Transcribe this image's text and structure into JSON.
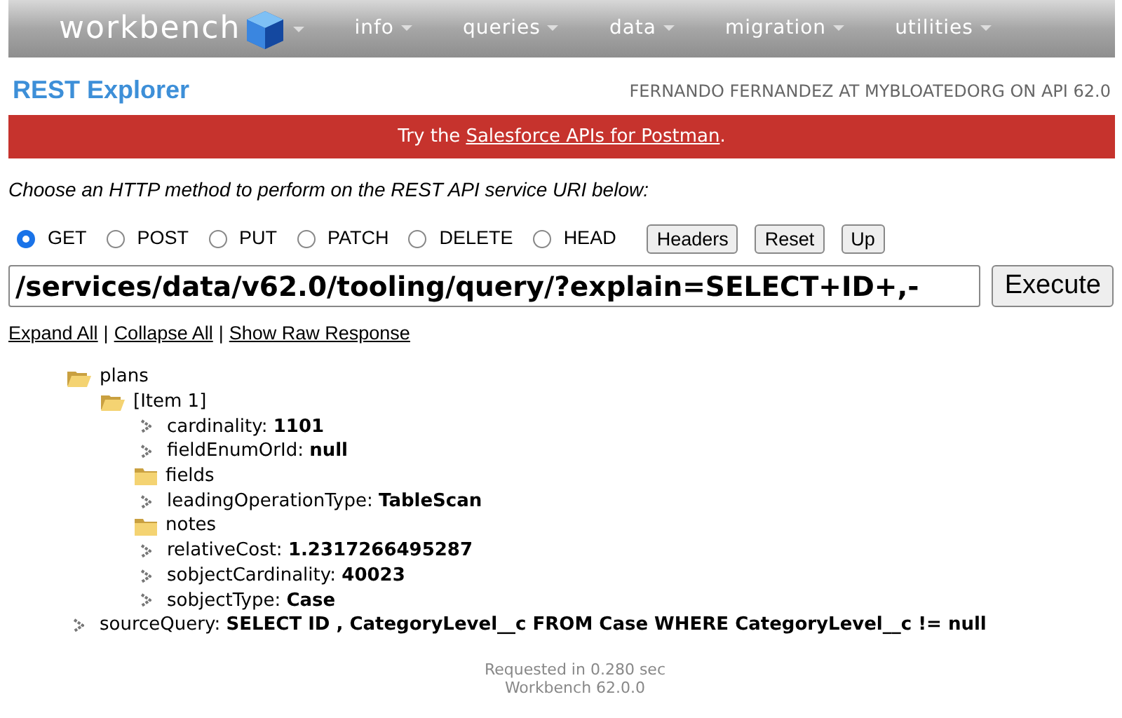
{
  "navbar": {
    "brand": "workbench",
    "menus": [
      "info",
      "queries",
      "data",
      "migration",
      "utilities"
    ]
  },
  "page_title": "REST Explorer",
  "user_info": "FERNANDO FERNANDEZ AT MYBLOATEDORG ON API 62.0",
  "banner": {
    "before": "Try the",
    "link": "Salesforce APIs for Postman",
    "after": "."
  },
  "instruction": "Choose an HTTP method to perform on the REST API service URI below:",
  "methods": [
    {
      "label": "GET",
      "selected": true
    },
    {
      "label": "POST",
      "selected": false
    },
    {
      "label": "PUT",
      "selected": false
    },
    {
      "label": "PATCH",
      "selected": false
    },
    {
      "label": "DELETE",
      "selected": false
    },
    {
      "label": "HEAD",
      "selected": false
    }
  ],
  "buttons": [
    "Headers",
    "Reset",
    "Up"
  ],
  "uri": {
    "value": "/services/data/v62.0/tooling/query/?explain=SELECT+ID+,-"
  },
  "execute_button": "Execute",
  "links": [
    "Expand All",
    "Collapse All",
    "Show Raw Response"
  ],
  "link_separator": "|",
  "tree": [
    {
      "kind": "folder",
      "label": "plans",
      "expanded": true,
      "children": [
        {
          "kind": "folder",
          "label": "[Item 1]",
          "expanded": true,
          "children": [
            {
              "kind": "leaf",
              "label": "cardinality:",
              "value": "1101"
            },
            {
              "kind": "leaf",
              "label": "fieldEnumOrId:",
              "value": "null"
            },
            {
              "kind": "folder",
              "label": "fields",
              "expanded": false
            },
            {
              "kind": "leaf",
              "label": "leadingOperationType:",
              "value": "TableScan"
            },
            {
              "kind": "folder",
              "label": "notes",
              "expanded": false
            },
            {
              "kind": "leaf",
              "label": "relativeCost:",
              "value": "1.2317266495287"
            },
            {
              "kind": "leaf",
              "label": "sobjectCardinality:",
              "value": "40023"
            },
            {
              "kind": "leaf",
              "label": "sobjectType:",
              "value": "Case"
            }
          ]
        }
      ]
    },
    {
      "kind": "leaf",
      "label": "sourceQuery:",
      "value": "SELECT ID , CategoryLevel__c FROM Case WHERE CategoryLevel__c != null"
    }
  ],
  "footer": [
    "Requested in 0.280 sec",
    "Workbench 62.0.0"
  ]
}
